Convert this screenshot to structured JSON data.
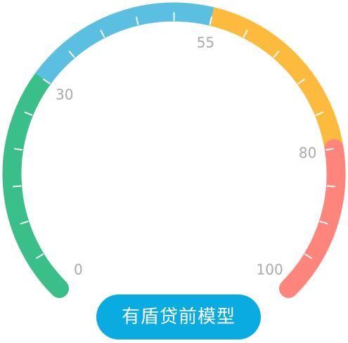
{
  "gauge": {
    "min": 0,
    "max": 100,
    "segments": [
      {
        "from": 0,
        "to": 30,
        "color": "#3bbf88",
        "status": "green"
      },
      {
        "from": 30,
        "to": 55,
        "color": "#5bbfe2",
        "status": "blue"
      },
      {
        "from": 55,
        "to": 80,
        "color": "#fdbb3d",
        "status": "yellow"
      },
      {
        "from": 80,
        "to": 100,
        "color": "#fd857c",
        "status": "red"
      }
    ],
    "major_ticks": [
      "0",
      "30",
      "55",
      "80",
      "100"
    ],
    "tick_count": 20,
    "label_color": "#aaaaaa",
    "tick_color": "#ffffff"
  },
  "model_button": {
    "label": "有盾贷前模型",
    "background": "#0aabe1",
    "text_color": "#ffffff"
  }
}
